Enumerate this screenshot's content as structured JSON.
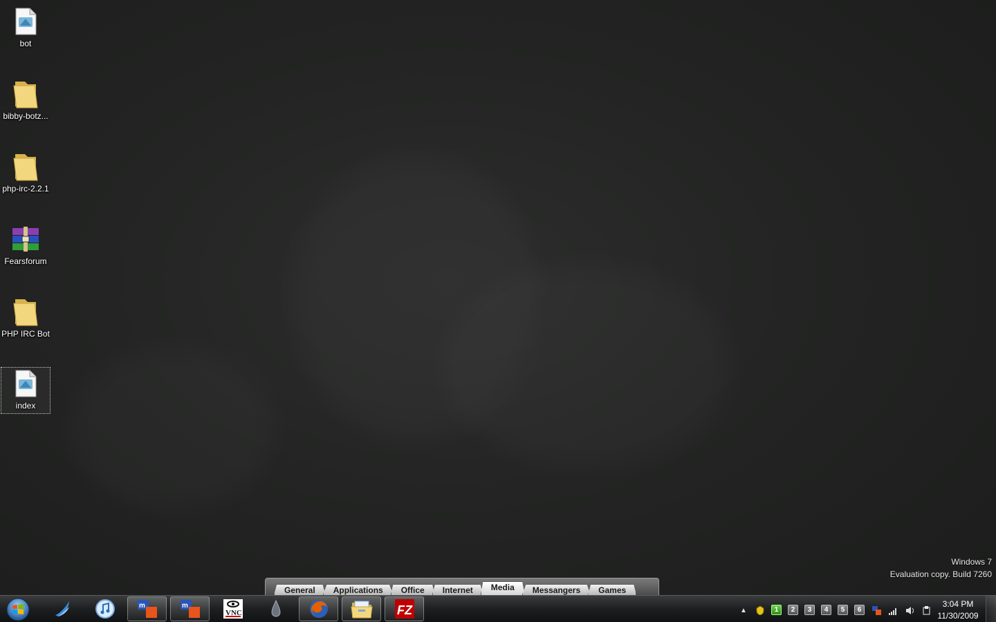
{
  "desktop": {
    "icons": [
      {
        "label": "bot",
        "icon": "text-document-icon"
      },
      {
        "label": "bibby-botz...",
        "icon": "folder-icon"
      },
      {
        "label": "php-irc-2.2.1",
        "icon": "folder-icon"
      },
      {
        "label": "Fearsforum",
        "icon": "winrar-archive-icon"
      },
      {
        "label": "PHP IRC Bot",
        "icon": "folder-icon"
      },
      {
        "label": "index",
        "icon": "text-document-icon",
        "selected": true
      }
    ]
  },
  "watermark": {
    "line1": "Windows 7",
    "line2": "Evaluation copy. Build 7260"
  },
  "dock": {
    "tabs": [
      {
        "label": "General"
      },
      {
        "label": "Applications"
      },
      {
        "label": "Office"
      },
      {
        "label": "Internet"
      },
      {
        "label": "Media",
        "active": true
      },
      {
        "label": "Messangers"
      },
      {
        "label": "Games"
      }
    ]
  },
  "taskbar": {
    "pinned": [
      {
        "icon": "windows-live-messenger-icon",
        "running": false
      },
      {
        "icon": "itunes-icon",
        "running": false
      },
      {
        "icon": "mirc-icon",
        "running": true
      },
      {
        "icon": "mirc-icon",
        "running": true
      },
      {
        "icon": "vnc-icon",
        "running": false
      },
      {
        "icon": "ink-drop-icon",
        "running": false
      },
      {
        "icon": "firefox-icon",
        "running": true
      },
      {
        "icon": "windows-explorer-icon",
        "running": true
      },
      {
        "icon": "filezilla-icon",
        "running": true
      }
    ],
    "tray": {
      "virtual_desktops": [
        "1",
        "2",
        "3",
        "4",
        "5",
        "6"
      ],
      "active_desktop": "1",
      "time": "3:04 PM",
      "date": "11/30/2009"
    }
  },
  "colors": {
    "desktop_bg": "#232423",
    "taskbar_bg": "#1d1f20",
    "folder_yellow": "#e8c766",
    "firefox_orange": "#e66000",
    "filezilla_red": "#bf0000"
  }
}
